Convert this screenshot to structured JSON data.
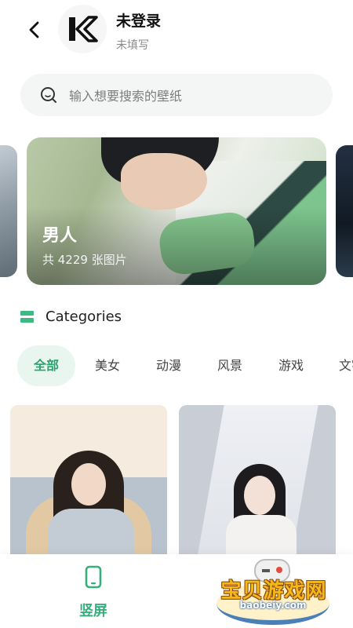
{
  "header": {
    "back_icon": "chevron-left-icon",
    "avatar_logo": "K",
    "user_name": "未登录",
    "user_sub": "未填写"
  },
  "search": {
    "icon": "search-icon",
    "placeholder": "输入想要搜索的壁纸"
  },
  "featured": {
    "title": "男人",
    "count_text": "共 4229 张图片"
  },
  "categories": {
    "title": "Categories",
    "tabs": [
      {
        "label": "全部",
        "active": true
      },
      {
        "label": "美女",
        "active": false
      },
      {
        "label": "动漫",
        "active": false
      },
      {
        "label": "风景",
        "active": false
      },
      {
        "label": "游戏",
        "active": false
      },
      {
        "label": "文字",
        "active": false
      }
    ]
  },
  "bottom_nav": {
    "items": [
      {
        "label": "竖屏",
        "icon": "phone-icon",
        "active": true
      }
    ]
  },
  "watermark": {
    "text": "宝贝游戏网",
    "url": "baobeiy.com"
  },
  "colors": {
    "accent": "#35b07c",
    "tab_active_bg": "#e9f6ef",
    "search_bg": "#f4f5f5"
  }
}
